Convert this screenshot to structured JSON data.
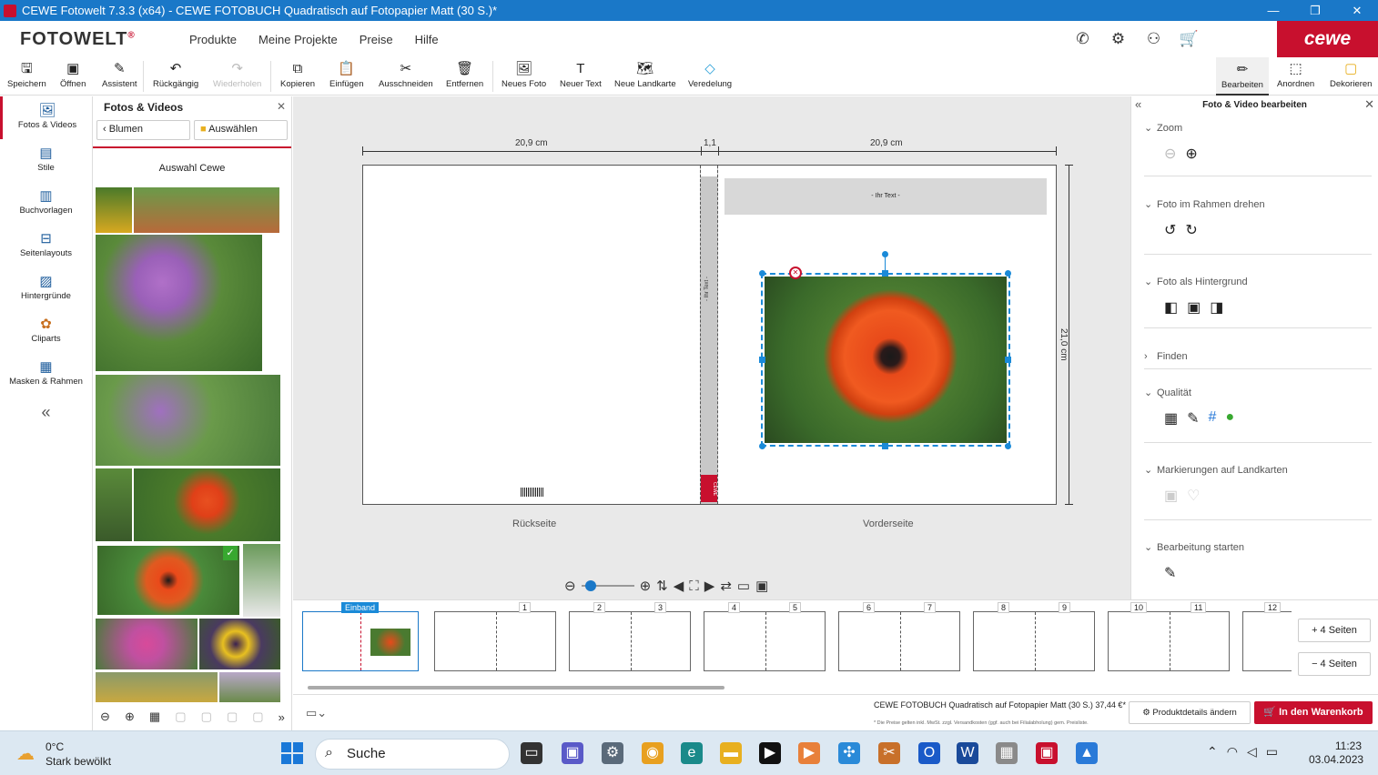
{
  "window": {
    "title": "CEWE Fotowelt 7.3.3 (x64) - CEWE FOTOBUCH Quadratisch auf Fotopapier Matt (30 S.)*",
    "minimize": "—",
    "maximize": "❐",
    "close": "✕"
  },
  "nav": {
    "logo": "FOTOWELT",
    "logo_mark": "®",
    "items": [
      "Produkte",
      "Meine Projekte",
      "Preise",
      "Hilfe"
    ],
    "brand": "cewe"
  },
  "toolbar": {
    "save": "Speichern",
    "open": "Öffnen",
    "assistant": "Assistent",
    "undo": "Rückgängig",
    "redo": "Wiederholen",
    "copy": "Kopieren",
    "paste": "Einfügen",
    "cut": "Ausschneiden",
    "remove": "Entfernen",
    "new_photo": "Neues Foto",
    "new_text": "Neuer Text",
    "new_map": "Neue Landkarte",
    "finish": "Veredelung",
    "edit": "Bearbeiten",
    "arrange": "Anordnen",
    "decorate": "Dekorieren"
  },
  "leftnav": {
    "items": [
      "Fotos & Videos",
      "Stile",
      "Buchvorlagen",
      "Seitenlayouts",
      "Hintergründe",
      "Cliparts",
      "Masken & Rahmen"
    ],
    "collapse": "«"
  },
  "photos": {
    "title": "Fotos & Videos",
    "close": "✕",
    "back_label": "Blumen",
    "select_label": "Auswählen",
    "selection": "Auswahl Cewe"
  },
  "canvas": {
    "dim_left": "20,9 cm",
    "dim_spine": "1,1",
    "dim_right": "20,9 cm",
    "dim_height": "21,0 cm",
    "text_placeholder": "- Ihr Text -",
    "spine_text": "- Ihr Text -",
    "spine_logo": "CEWE",
    "back_label": "Rückseite",
    "front_label": "Vorderseite"
  },
  "strip": {
    "cover_label": "Einband",
    "pages": [
      "1",
      "2",
      "3",
      "4",
      "5",
      "6",
      "7",
      "8",
      "9",
      "10",
      "11",
      "12"
    ],
    "add_pages": "4 Seiten",
    "remove_pages": "4 Seiten"
  },
  "rpanel": {
    "title": "Foto & Video bearbeiten",
    "sections": [
      "Zoom",
      "Foto im Rahmen drehen",
      "Foto als Hintergrund",
      "Finden",
      "Qualität",
      "Markierungen auf Landkarten",
      "Bearbeitung starten"
    ]
  },
  "bottom": {
    "product": "CEWE FOTOBUCH Quadratisch auf Fotopapier Matt (30 S.) 37,44 €*",
    "note": "* Die Preise gelten inkl. MwSt. zzgl. Versandkosten (ggf. auch bei Filialabholung) gem. Preisliste.",
    "details": "Produktdetails ändern",
    "cart": "In den Warenkorb"
  },
  "taskbar": {
    "temp": "0°C",
    "weather": "Stark bewölkt",
    "search": "Suche",
    "time": "11:23",
    "date": "03.04.2023"
  },
  "colors": {
    "accent": "#c8102e",
    "selection": "#1a8ad8",
    "titlebar": "#1a78c8"
  }
}
